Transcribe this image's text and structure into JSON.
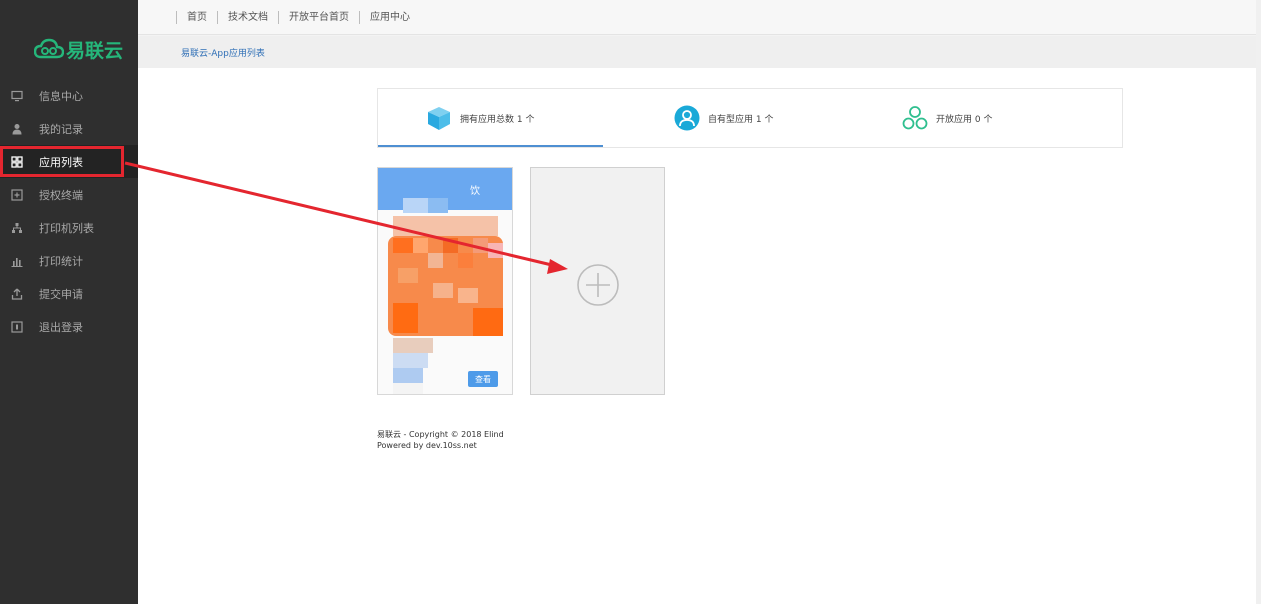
{
  "sidebar": {
    "logo_text": "易联云",
    "items": [
      {
        "label": "信息中心",
        "icon": "monitor-icon"
      },
      {
        "label": "我的记录",
        "icon": "user-icon"
      },
      {
        "label": "应用列表",
        "icon": "grid-icon",
        "active": true
      },
      {
        "label": "授权终端",
        "icon": "terminal-plus-icon"
      },
      {
        "label": "打印机列表",
        "icon": "network-icon"
      },
      {
        "label": "打印统计",
        "icon": "bar-chart-icon"
      },
      {
        "label": "提交申请",
        "icon": "upload-icon"
      },
      {
        "label": "退出登录",
        "icon": "exit-icon"
      }
    ]
  },
  "topnav": [
    "首页",
    "技术文档",
    "开放平台首页",
    "应用中心"
  ],
  "breadcrumb": "易联云-App应用列表",
  "stats": [
    {
      "label": "拥有应用总数 1 个",
      "icon": "cube-icon"
    },
    {
      "label": "自有型应用 1 个",
      "icon": "user-circle-icon"
    },
    {
      "label": "开放应用 0 个",
      "icon": "share-nodes-icon"
    }
  ],
  "app_card": {
    "title": "饮",
    "view_label": "查看"
  },
  "footer": {
    "line1": "易联云 - Copyright © 2018 Elind",
    "line2": "Powered by dev.10ss.net"
  },
  "colors": {
    "sidebar_bg": "#2f2f2f",
    "brand_green": "#25b67a",
    "accent_blue": "#4e8fd2",
    "annotation_red": "#e4262f"
  }
}
